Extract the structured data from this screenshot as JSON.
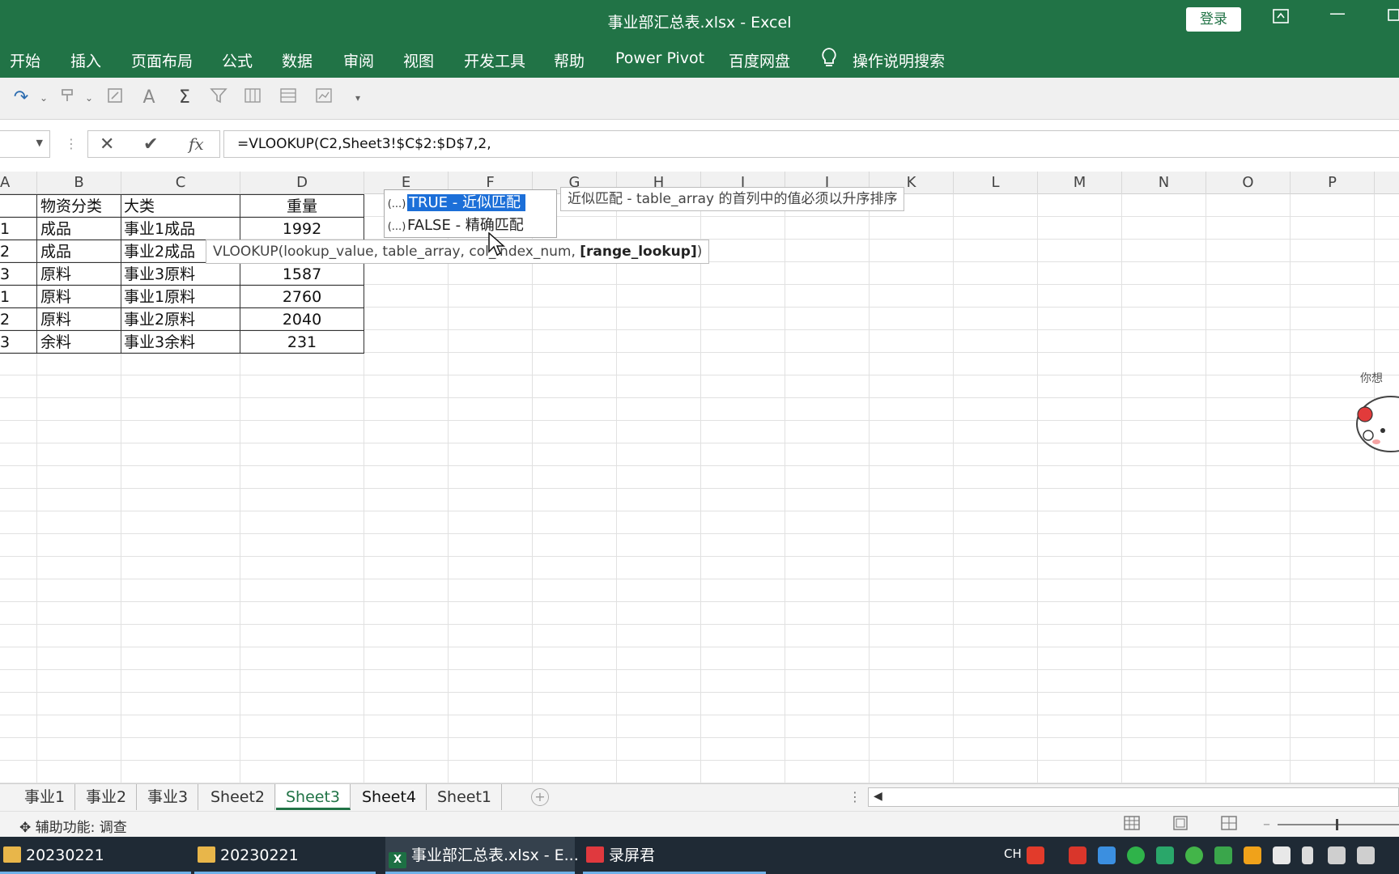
{
  "window": {
    "title": "事业部汇总表.xlsx  -  Excel",
    "login_label": "登录"
  },
  "ribbon_tabs": [
    "开始",
    "插入",
    "页面布局",
    "公式",
    "数据",
    "审阅",
    "视图",
    "开发工具",
    "帮助",
    "Power Pivot",
    "百度网盘",
    "操作说明搜索"
  ],
  "formula_bar": {
    "name_box": "",
    "cancel_symbol": "✕",
    "enter_symbol": "✔",
    "fx_label": "fx",
    "formula": "=VLOOKUP(C2,Sheet3!$C$2:$D$7,2,"
  },
  "columns": [
    "A",
    "B",
    "C",
    "D",
    "E",
    "F",
    "G",
    "H",
    "I",
    "J",
    "K",
    "L",
    "M",
    "N",
    "O",
    "P"
  ],
  "table": {
    "headers": [
      "",
      "物资分类",
      "大类",
      "重量"
    ],
    "rows": [
      [
        "1",
        "成品",
        "事业1成品",
        "1992"
      ],
      [
        "2",
        "成品",
        "事业2成品",
        ""
      ],
      [
        "3",
        "原料",
        "事业3原料",
        "1587"
      ],
      [
        "1",
        "原料",
        "事业1原料",
        "2760"
      ],
      [
        "2",
        "原料",
        "事业2原料",
        "2040"
      ],
      [
        "3",
        "余料",
        "事业3余料",
        "231"
      ]
    ]
  },
  "autocomplete": {
    "items": [
      {
        "icon": "(...)",
        "label": "TRUE - 近似匹配",
        "selected": true
      },
      {
        "icon": "(...)",
        "label": "FALSE - 精确匹配",
        "selected": false
      }
    ],
    "description": "近似匹配 - table_array 的首列中的值必须以升序排序"
  },
  "function_tooltip": {
    "prefix": "VLOOKUP(lookup_value, table_array, col_index_num, ",
    "current_arg": "[range_lookup]",
    "suffix": ")"
  },
  "sheet_tabs": [
    {
      "label": "事业1",
      "active": false
    },
    {
      "label": "事业2",
      "active": false
    },
    {
      "label": "事业3",
      "active": false
    },
    {
      "label": "Sheet2",
      "active": false
    },
    {
      "label": "Sheet3",
      "active": true
    },
    {
      "label": "Sheet4",
      "active": false
    },
    {
      "label": "Sheet1",
      "active": false
    }
  ],
  "status_bar": {
    "accessibility": "辅助功能: 调查"
  },
  "taskbar": {
    "items": [
      {
        "label": "20230221",
        "icon": "folder-icon"
      },
      {
        "label": "20230221",
        "icon": "folder-icon"
      },
      {
        "label": "事业部汇总表.xlsx - E...",
        "icon": "excel-icon"
      },
      {
        "label": "录屏君",
        "icon": "recorder-icon"
      }
    ],
    "ime_label": "CH"
  },
  "colors": {
    "excel_green": "#217346",
    "selection_blue": "#1c6fd8"
  }
}
